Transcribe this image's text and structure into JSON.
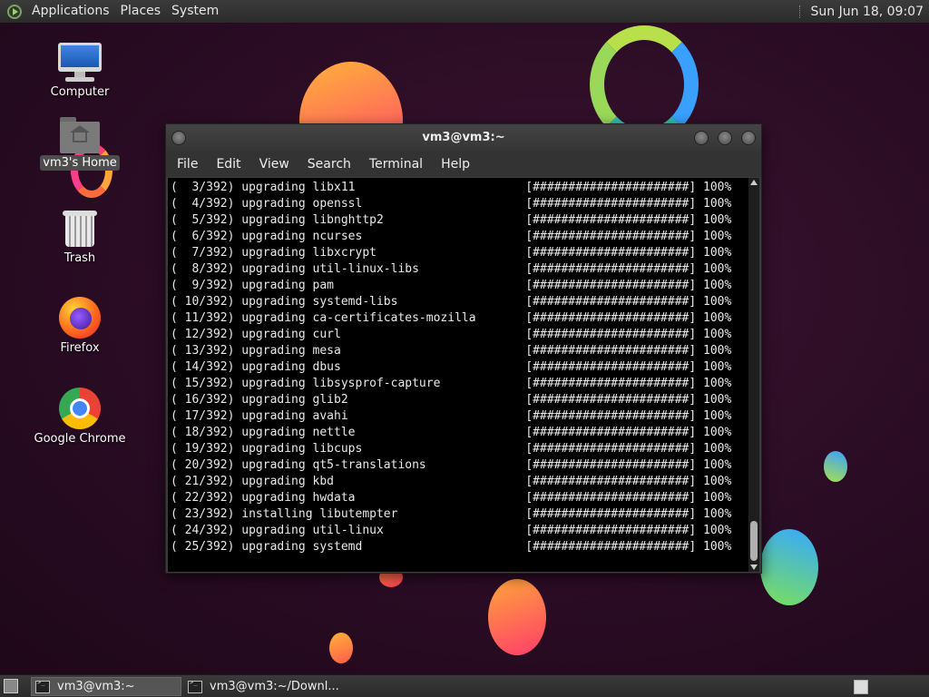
{
  "top_panel": {
    "menus": [
      "Applications",
      "Places",
      "System"
    ],
    "clock": "Sun Jun 18, 09:07"
  },
  "desktop_icons": [
    {
      "label": "Computer"
    },
    {
      "label": "vm3's Home"
    },
    {
      "label": "Trash"
    },
    {
      "label": "Firefox"
    },
    {
      "label": "Google Chrome"
    }
  ],
  "terminal": {
    "title": "vm3@vm3:~",
    "menu": [
      "File",
      "Edit",
      "View",
      "Search",
      "Terminal",
      "Help"
    ],
    "lines": [
      "(  3/392) upgrading libx11                        [######################] 100%",
      "(  4/392) upgrading openssl                       [######################] 100%",
      "(  5/392) upgrading libnghttp2                    [######################] 100%",
      "(  6/392) upgrading ncurses                       [######################] 100%",
      "(  7/392) upgrading libxcrypt                     [######################] 100%",
      "(  8/392) upgrading util-linux-libs               [######################] 100%",
      "(  9/392) upgrading pam                           [######################] 100%",
      "( 10/392) upgrading systemd-libs                  [######################] 100%",
      "( 11/392) upgrading ca-certificates-mozilla       [######################] 100%",
      "( 12/392) upgrading curl                          [######################] 100%",
      "( 13/392) upgrading mesa                          [######################] 100%",
      "( 14/392) upgrading dbus                          [######################] 100%",
      "( 15/392) upgrading libsysprof-capture            [######################] 100%",
      "( 16/392) upgrading glib2                         [######################] 100%",
      "( 17/392) upgrading avahi                         [######################] 100%",
      "( 18/392) upgrading nettle                        [######################] 100%",
      "( 19/392) upgrading libcups                       [######################] 100%",
      "( 20/392) upgrading qt5-translations              [######################] 100%",
      "( 21/392) upgrading kbd                           [######################] 100%",
      "( 22/392) upgrading hwdata                        [######################] 100%",
      "( 23/392) installing libutempter                  [######################] 100%",
      "( 24/392) upgrading util-linux                    [######################] 100%",
      "( 25/392) upgrading systemd                       [######################] 100%"
    ]
  },
  "taskbar": {
    "tasks": [
      {
        "label": "vm3@vm3:~",
        "active": true
      },
      {
        "label": "vm3@vm3:~/Downl...",
        "active": false
      }
    ]
  }
}
